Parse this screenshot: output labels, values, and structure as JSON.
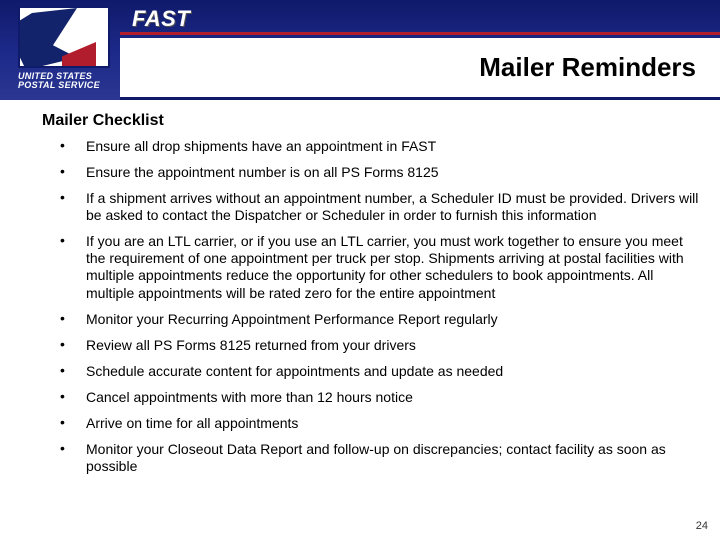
{
  "header": {
    "app_title": "FAST",
    "slide_title": "Mailer Reminders",
    "org_line1": "UNITED STATES",
    "org_line2": "POSTAL SERVICE"
  },
  "body": {
    "section_heading": "Mailer Checklist",
    "bullets": [
      "Ensure all drop shipments have an appointment in FAST",
      "Ensure the appointment number is on all PS Forms 8125",
      "If a shipment arrives without an appointment number, a Scheduler ID must be provided. Drivers will be asked to contact the Dispatcher or Scheduler in order to furnish this information",
      "If you are an LTL carrier, or if you use an LTL carrier, you must work together to ensure you meet the requirement of one appointment per truck per stop. Shipments arriving at postal facilities with multiple appointments reduce the opportunity for other schedulers to book appointments.  All multiple appointments will be rated zero for the entire appointment",
      "Monitor your Recurring Appointment Performance Report regularly",
      "Review all PS Forms 8125 returned from your drivers",
      "Schedule accurate content for appointments and update as needed",
      "Cancel appointments with more than 12 hours notice",
      "Arrive on time for all appointments",
      "Monitor your Closeout Data Report and follow-up on discrepancies; contact facility as soon as possible"
    ]
  },
  "footer": {
    "page_number": "24"
  },
  "colors": {
    "navy": "#13236b",
    "red": "#b11d2c"
  }
}
